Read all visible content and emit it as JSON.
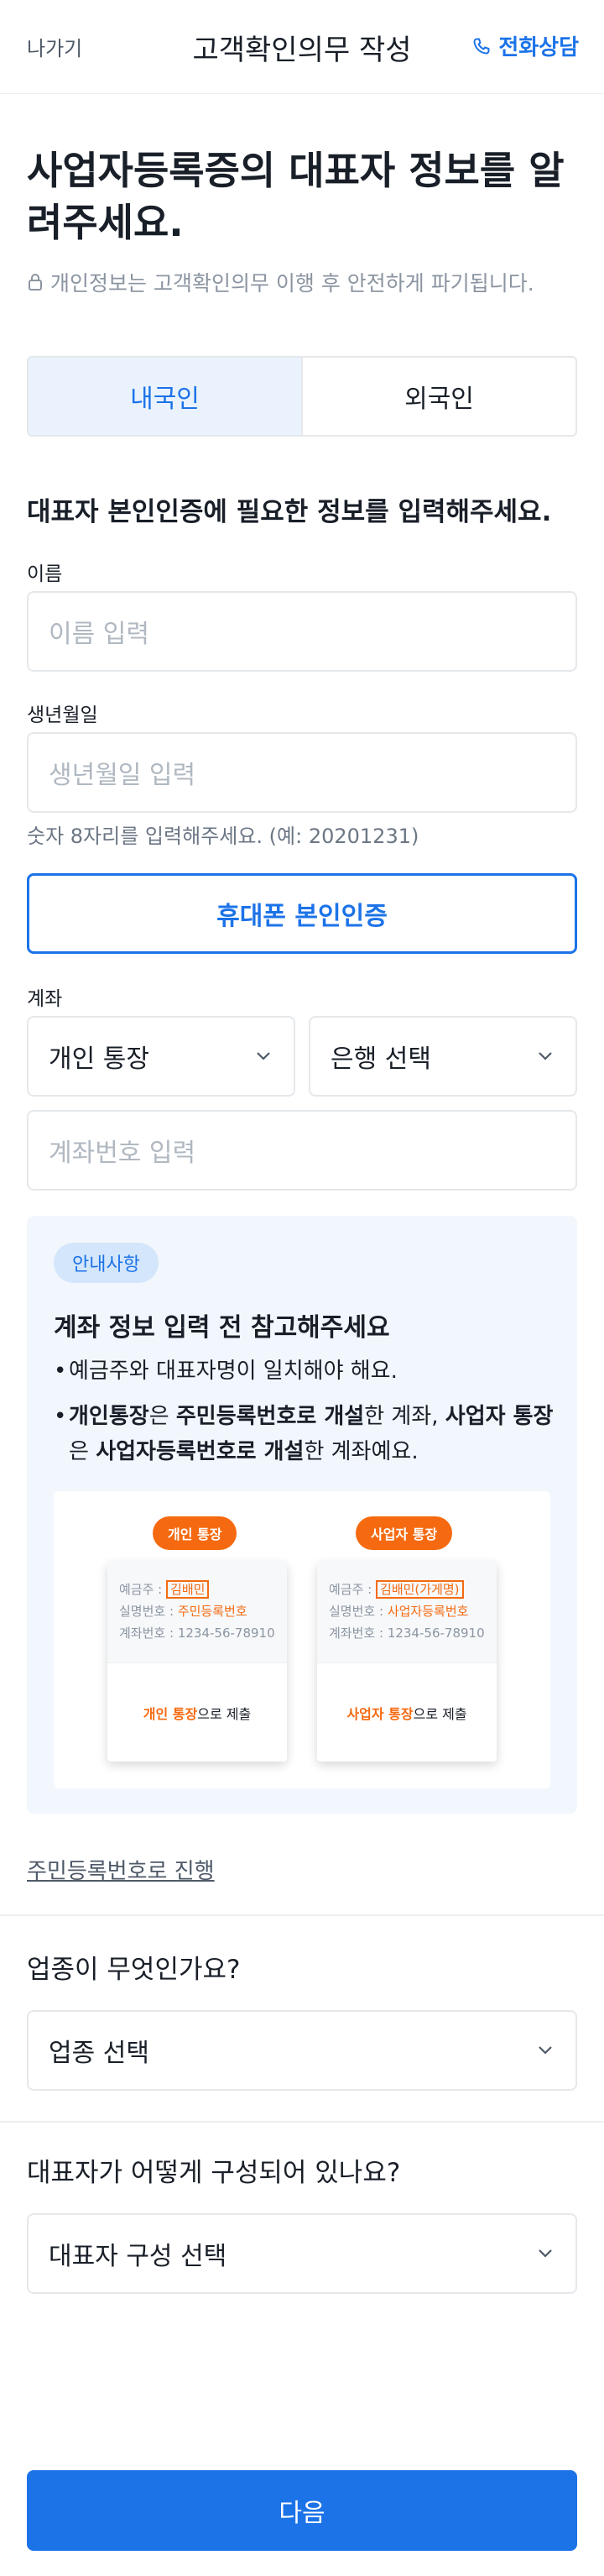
{
  "header": {
    "back_label": "나가기",
    "title": "고객확인의무 작성",
    "call_label": "전화상담"
  },
  "headline": "사업자등록증의 대표자 정보를 알려주세요.",
  "privacy_note": "개인정보는 고객확인의무 이행 후 안전하게 파기됩니다.",
  "nationality_tabs": {
    "domestic": "내국인",
    "foreign": "외국인",
    "selected": "내국인"
  },
  "verify_section": {
    "title": "대표자 본인인증에 필요한 정보를 입력해주세요.",
    "name_label": "이름",
    "name_placeholder": "이름 입력",
    "birth_label": "생년월일",
    "birth_placeholder": "생년월일 입력",
    "birth_hint": "숫자 8자리를 입력해주세요. (예: 20201231)",
    "verify_button": "휴대폰 본인인증"
  },
  "account_section": {
    "label": "계좌",
    "type_selected": "개인 통장",
    "bank_placeholder": "은행 선택",
    "number_placeholder": "계좌번호 입력"
  },
  "notice": {
    "badge": "안내사항",
    "title": "계좌 정보 입력 전 참고해주세요",
    "bullet1": "예금주와 대표자명이 일치해야 해요.",
    "bullet2": {
      "p1": "개인통장",
      "p2": "은 ",
      "p3": "주민등록번호로 개설",
      "p4": "한 계좌, ",
      "p5": "사업자 통장",
      "p6": "은 ",
      "p7": "사업자등록번호로 개설",
      "p8": "한 계좌예요."
    },
    "personal_card": {
      "pill": "개인 통장",
      "holder_label": "예금주 :",
      "holder_value": "김배민",
      "id_label": "실명번호 :",
      "id_value": "주민등록번호",
      "acct_label": "계좌번호 :",
      "acct_value": "1234-56-78910",
      "submit_hl": "개인 통장",
      "submit_rest": "으로 제출"
    },
    "business_card": {
      "pill": "사업자 통장",
      "holder_label": "예금주 :",
      "holder_value": "김배민(가게명)",
      "id_label": "실명번호 :",
      "id_value": "사업자등록번호",
      "acct_label": "계좌번호 :",
      "acct_value": "1234-56-78910",
      "submit_hl": "사업자 통장",
      "submit_rest": "으로 제출"
    }
  },
  "alt_link": "주민등록번호로 진행",
  "industry": {
    "question": "업종이 무엇인가요?",
    "placeholder": "업종 선택"
  },
  "composition": {
    "question": "대표자가 어떻게 구성되어 있나요?",
    "placeholder": "대표자 구성 선택"
  },
  "next_button": "다음",
  "colors": {
    "primary": "#1c73e8",
    "accent_orange": "#f56a10",
    "border": "#e5e8eb",
    "placeholder": "#b0b8c1"
  },
  "icons": {
    "call": "phone-icon",
    "privacy": "lock-icon",
    "dropdown": "chevron-down-icon"
  }
}
